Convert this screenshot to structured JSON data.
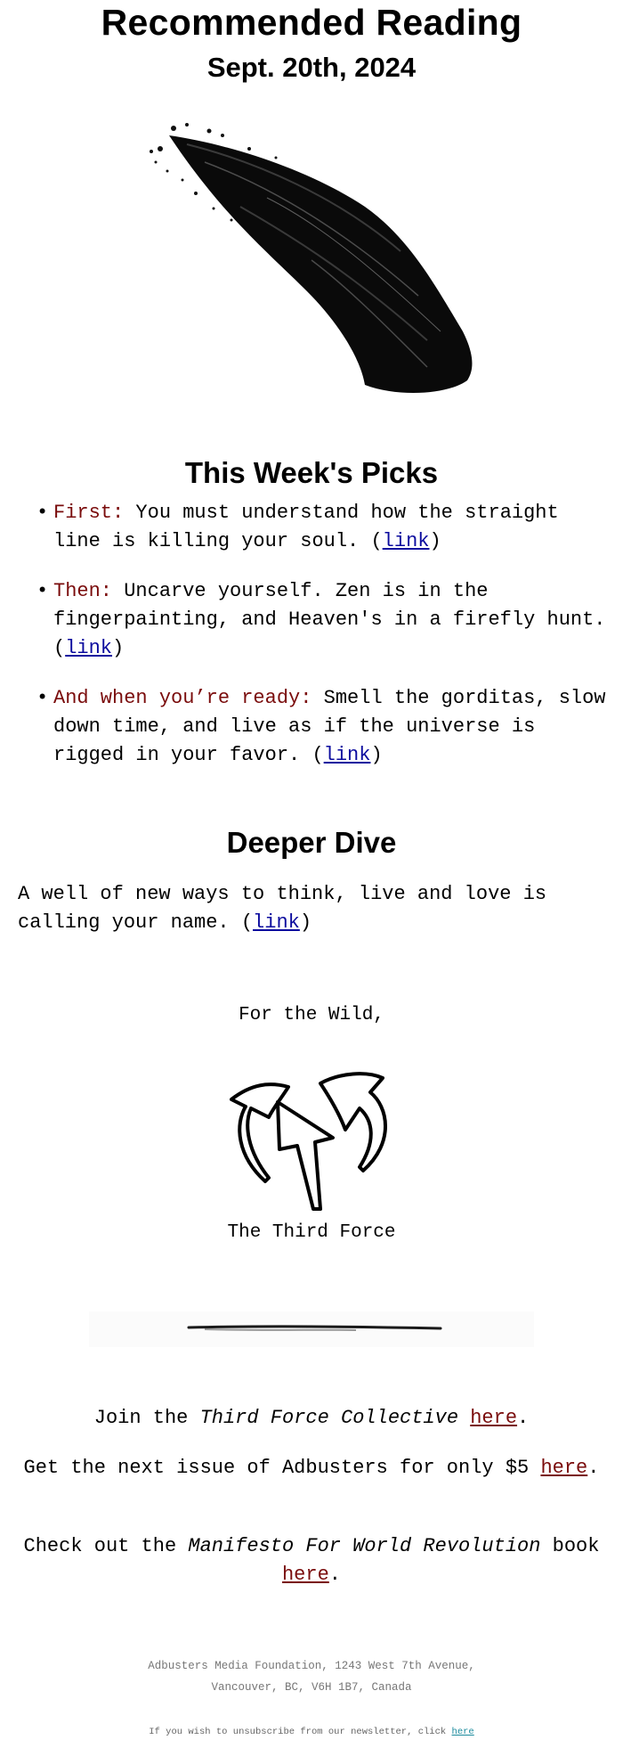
{
  "header": {
    "title": "Recommended Reading",
    "date": "Sept. 20th, 2024"
  },
  "hero_image": {
    "icon": "ink-brush-stroke-image"
  },
  "picks": {
    "heading": "This Week's Picks",
    "items": [
      {
        "lead": "First:",
        "text": " You must understand how the straight line is killing your soul. (",
        "link": "link",
        "tail": ")"
      },
      {
        "lead": "Then:",
        "text": " Uncarve yourself. Zen is in the fingerpainting, and Heaven's in a firefly hunt. (",
        "link": "link",
        "tail": ")"
      },
      {
        "lead": "And when you’re ready:",
        "text": " Smell the gorditas, slow down time, and live as if the universe is rigged in your favor. (",
        "link": "link",
        "tail": ")"
      }
    ]
  },
  "deeper_dive": {
    "heading": "Deeper Dive",
    "text": "A well of new ways to think, live and love is calling your name. (",
    "link": "link",
    "tail": ")"
  },
  "signoff": {
    "greeting": "For the Wild,",
    "logo_icon": "third-force-arrows-logo",
    "name": "The Third Force"
  },
  "divider": {
    "icon": "ink-line-divider"
  },
  "ctas": [
    {
      "pre": "Join the ",
      "italic": "Third Force Collective",
      "mid": " ",
      "link": "here",
      "post": "."
    },
    {
      "pre": "Get the next issue of Adbusters for only $5 ",
      "italic": "",
      "mid": "",
      "link": "here",
      "post": "."
    },
    {
      "pre": "Check out the ",
      "italic": "Manifesto For World Revolution",
      "mid": " book ",
      "link": "here",
      "post": "."
    }
  ],
  "footer": {
    "address_line1": "Adbusters Media Foundation, 1243 West 7th Avenue,",
    "address_line2": "Vancouver, BC, V6H 1B7, Canada",
    "unsubscribe_text": "If you wish to unsubscribe from our newsletter, click ",
    "unsubscribe_link": "here"
  },
  "colors": {
    "lead_red": "#7a0c0c",
    "link_blue": "#0b0b9e",
    "footer_gray": "#777777",
    "unsubscribe_teal": "#1a8a9c"
  }
}
